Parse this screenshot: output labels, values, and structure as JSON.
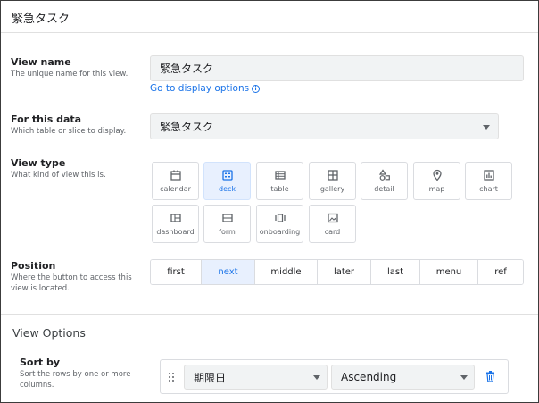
{
  "header": {
    "title": "緊急タスク"
  },
  "view_name": {
    "title": "View name",
    "desc": "The unique name for this view.",
    "value": "緊急タスク",
    "link": "Go to display options",
    "link_icon": "i"
  },
  "for_this_data": {
    "title": "For this data",
    "desc": "Which table or slice to display.",
    "value": "緊急タスク"
  },
  "view_type": {
    "title": "View type",
    "desc": "What kind of view this is.",
    "types": [
      {
        "label": "calendar",
        "icon": "calendar-icon"
      },
      {
        "label": "deck",
        "icon": "deck-icon",
        "selected": true
      },
      {
        "label": "table",
        "icon": "table-icon"
      },
      {
        "label": "gallery",
        "icon": "gallery-icon"
      },
      {
        "label": "detail",
        "icon": "detail-icon"
      },
      {
        "label": "map",
        "icon": "map-pin-icon"
      },
      {
        "label": "chart",
        "icon": "chart-icon"
      },
      {
        "label": "dashboard",
        "icon": "dashboard-icon"
      },
      {
        "label": "form",
        "icon": "form-icon"
      },
      {
        "label": "onboarding",
        "icon": "onboarding-icon"
      },
      {
        "label": "card",
        "icon": "card-icon"
      }
    ]
  },
  "position": {
    "title": "Position",
    "desc_line1": "Where the button to access this",
    "desc_line2": "view is located.",
    "options": [
      "first",
      "next",
      "middle",
      "later",
      "last",
      "menu",
      "ref"
    ],
    "selected": "next"
  },
  "view_options": {
    "title": "View Options",
    "sort_by": {
      "title": "Sort by",
      "desc_line1": "Sort the rows by one or more",
      "desc_line2": "columns.",
      "column": "期限日",
      "direction": "Ascending"
    }
  },
  "colors": {
    "accent": "#1a73e8",
    "selected_bg": "#e8f0fe",
    "field_bg": "#f1f3f4"
  }
}
